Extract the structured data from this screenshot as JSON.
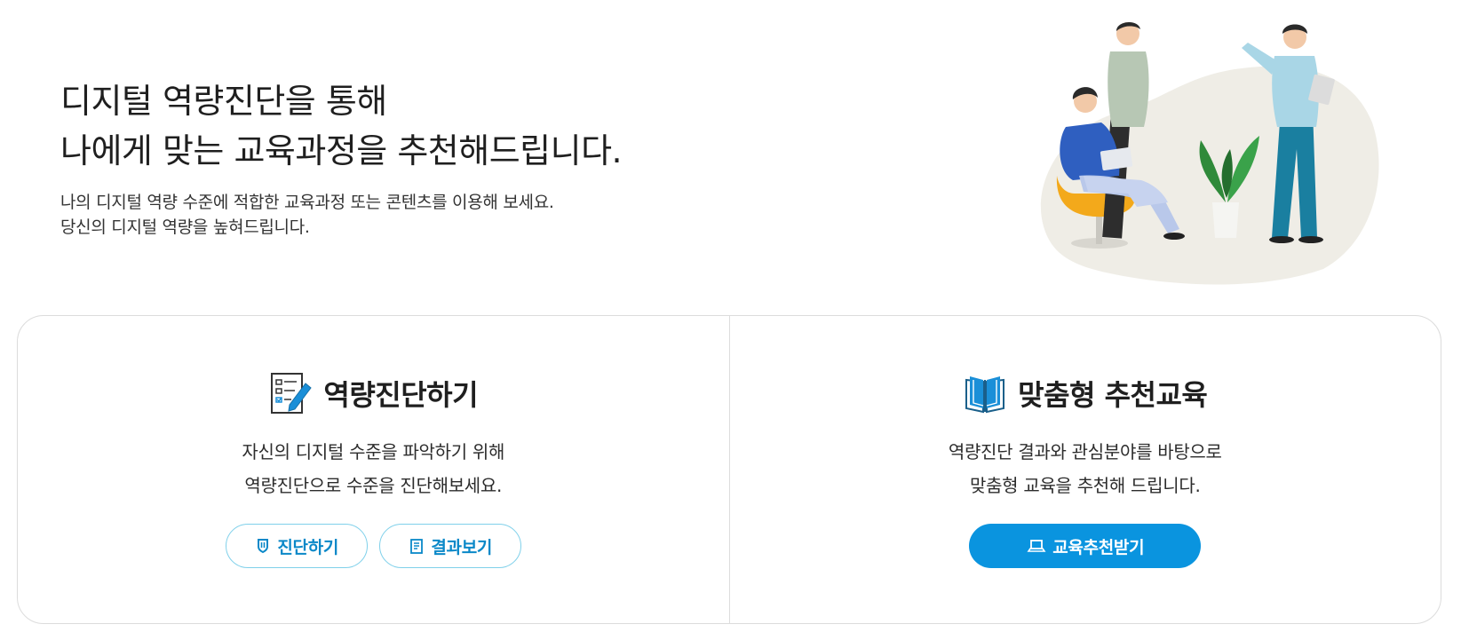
{
  "hero": {
    "title_line1": "디지털 역량진단을 통해",
    "title_line2": "나에게 맞는 교육과정을 추천해드립니다.",
    "desc_line1": "나의 디지털 역량 수준에 적합한 교육과정 또는 콘텐츠를 이용해 보세요.",
    "desc_line2": "당신의 디지털 역량을 높혀드립니다."
  },
  "cards": {
    "diagnosis": {
      "icon": "checklist-pencil-icon",
      "title": "역량진단하기",
      "desc_line1": "자신의 디지털 수준을 파악하기 위해",
      "desc_line2": "역량진단으로 수준을 진단해보세요.",
      "buttons": [
        {
          "label": "진단하기",
          "icon": "shield-icon"
        },
        {
          "label": "결과보기",
          "icon": "document-icon"
        }
      ]
    },
    "recommend": {
      "icon": "open-book-icon",
      "title": "맞춤형 추천교육",
      "desc_line1": "역량진단 결과와 관심분야를 바탕으로",
      "desc_line2": "맞춤형 교육을 추천해 드립니다.",
      "button": {
        "label": "교육추천받기",
        "icon": "laptop-icon"
      }
    }
  },
  "colors": {
    "accent": "#0a94df",
    "outline_border": "#7fd0ea",
    "outline_text": "#0a88c8",
    "panel_border": "#dcdcdc"
  }
}
